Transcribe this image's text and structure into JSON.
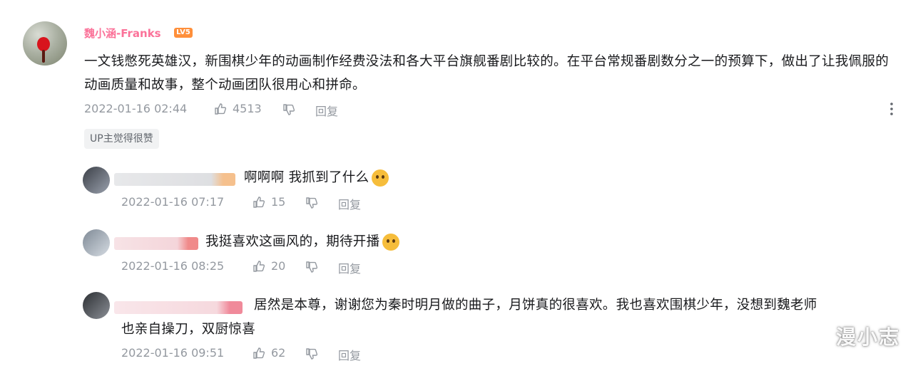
{
  "main_comment": {
    "username": "魏小涵-Franks",
    "level": "LV5",
    "content": "一文钱憋死英雄汉，新围棋少年的动画制作经费没法和各大平台旗舰番剧比较的。在平台常规番剧数分之一的预算下，做出了让我佩服的动画质量和故事，整个动画团队很用心和拼命。",
    "time": "2022-01-16 02:44",
    "likes": "4513",
    "reply_label": "回复",
    "up_liked": "UP主觉得很赞"
  },
  "replies": [
    {
      "text": "啊啊啊 我抓到了什么",
      "time": "2022-01-16 07:17",
      "likes": "15",
      "reply_label": "回复",
      "emoji": "cat-face"
    },
    {
      "text": "我挺喜欢这画风的，期待开播",
      "time": "2022-01-16 08:25",
      "likes": "20",
      "reply_label": "回复",
      "emoji": "shocked-face"
    },
    {
      "text": "居然是本尊，谢谢您为秦时明月做的曲子，月饼真的很喜欢。我也喜欢围棋少年，没想到魏老师",
      "text2": "也亲自操刀，双厨惊喜",
      "time": "2022-01-16 09:51",
      "likes": "62",
      "reply_label": "回复"
    }
  ],
  "watermark": "漫小志",
  "colors": {
    "username": "#fb7299",
    "meta": "#9499a0",
    "level_badge": "#ff8f3a"
  }
}
